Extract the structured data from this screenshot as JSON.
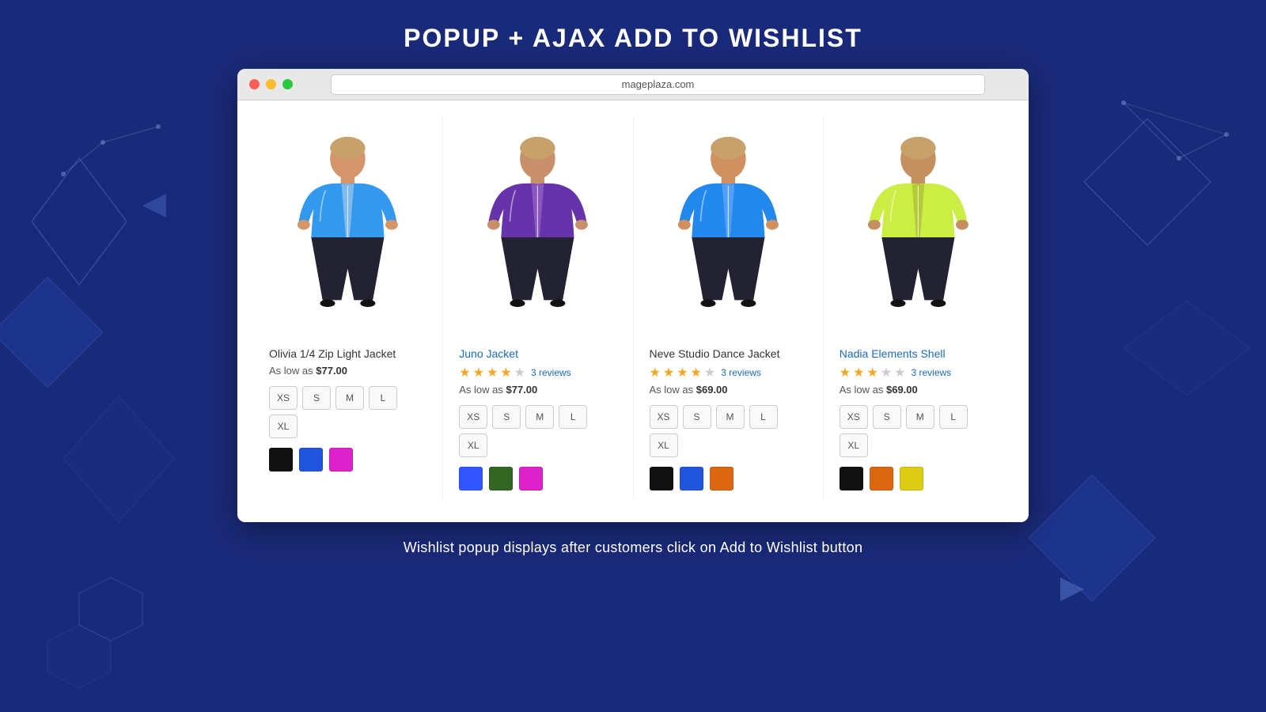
{
  "page": {
    "title": "POPUP + AJAX ADD TO WISHLIST",
    "subtitle": "Wishlist popup displays after customers click on Add to Wishlist button",
    "browser_url": "mageplaza.com"
  },
  "products": [
    {
      "id": "p1",
      "name": "Olivia 1/4 Zip Light Jacket",
      "is_link": false,
      "has_stars": false,
      "reviews_count": null,
      "price_prefix": "As low as",
      "price": "$77.00",
      "sizes": [
        "XS",
        "S",
        "M",
        "L",
        "XL"
      ],
      "colors": [
        "#111111",
        "#2255dd",
        "#dd22cc"
      ],
      "jacket_color": "#3399ee",
      "accent_color": "#a0c8f0"
    },
    {
      "id": "p2",
      "name": "Juno Jacket",
      "is_link": true,
      "has_stars": true,
      "stars_filled": 4,
      "stars_total": 5,
      "reviews_count": "3 reviews",
      "price_prefix": "As low as",
      "price": "$77.00",
      "sizes": [
        "XS",
        "S",
        "M",
        "L",
        "XL"
      ],
      "colors": [
        "#3355ff",
        "#336622",
        "#dd22cc"
      ],
      "jacket_color": "#6633aa",
      "accent_color": "#9966cc"
    },
    {
      "id": "p3",
      "name": "Neve Studio Dance Jacket",
      "is_link": false,
      "has_stars": true,
      "stars_filled": 4,
      "stars_total": 5,
      "reviews_count": "3 reviews",
      "price_prefix": "As low as",
      "price": "$69.00",
      "sizes": [
        "XS",
        "S",
        "M",
        "L",
        "XL"
      ],
      "colors": [
        "#111111",
        "#2255dd",
        "#dd6611"
      ],
      "jacket_color": "#2288ee",
      "accent_color": "#66aaff"
    },
    {
      "id": "p4",
      "name": "Nadia Elements Shell",
      "is_link": true,
      "has_stars": true,
      "stars_filled": 3,
      "stars_total": 5,
      "reviews_count": "3 reviews",
      "price_prefix": "As low as",
      "price": "$69.00",
      "sizes": [
        "XS",
        "S",
        "M",
        "L",
        "XL"
      ],
      "colors": [
        "#111111",
        "#dd6611",
        "#ddcc11"
      ],
      "jacket_color": "#ccee44",
      "accent_color": "#aabb33"
    }
  ]
}
